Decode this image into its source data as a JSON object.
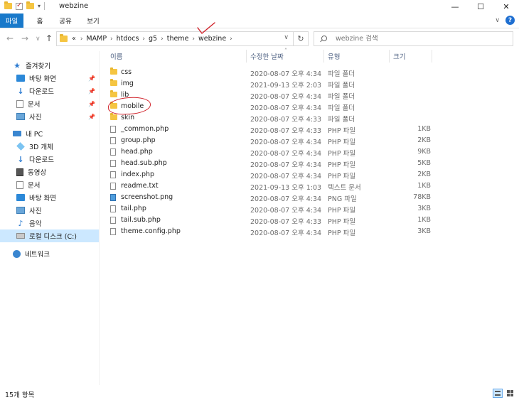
{
  "window": {
    "title": "webzine",
    "minimize": "—",
    "maximize": "☐",
    "close": "✕"
  },
  "ribbon": {
    "tabs": [
      "파일",
      "홈",
      "공유",
      "보기"
    ]
  },
  "address": {
    "prefix": "«",
    "crumbs": [
      "MAMP",
      "htdocs",
      "g5",
      "theme",
      "webzine"
    ],
    "search_placeholder": "webzine 검색"
  },
  "sidebar": {
    "quick_access": "즐겨찾기",
    "quick_items": [
      "바탕 화면",
      "다운로드",
      "문서",
      "사진"
    ],
    "this_pc": "내 PC",
    "pc_items": [
      "3D 개체",
      "다운로드",
      "동영상",
      "문서",
      "바탕 화면",
      "사진",
      "음악",
      "로컬 디스크 (C:)"
    ],
    "network": "네트워크",
    "selected": "로컬 디스크 (C:)"
  },
  "columns": {
    "name": "이름",
    "date": "수정한 날짜",
    "type": "유형",
    "size": "크기"
  },
  "files": [
    {
      "name": "css",
      "date": "2020-08-07 오후 4:34",
      "type": "파일 폴더",
      "size": "",
      "kind": "folder"
    },
    {
      "name": "img",
      "date": "2021-09-13 오후 2:03",
      "type": "파일 폴더",
      "size": "",
      "kind": "folder"
    },
    {
      "name": "lib",
      "date": "2020-08-07 오후 4:34",
      "type": "파일 폴더",
      "size": "",
      "kind": "folder"
    },
    {
      "name": "mobile",
      "date": "2020-08-07 오후 4:34",
      "type": "파일 폴더",
      "size": "",
      "kind": "folder"
    },
    {
      "name": "skin",
      "date": "2020-08-07 오후 4:33",
      "type": "파일 폴더",
      "size": "",
      "kind": "folder"
    },
    {
      "name": "_common.php",
      "date": "2020-08-07 오후 4:33",
      "type": "PHP 파일",
      "size": "1KB",
      "kind": "file"
    },
    {
      "name": "group.php",
      "date": "2020-08-07 오후 4:34",
      "type": "PHP 파일",
      "size": "2KB",
      "kind": "file"
    },
    {
      "name": "head.php",
      "date": "2020-08-07 오후 4:34",
      "type": "PHP 파일",
      "size": "9KB",
      "kind": "file"
    },
    {
      "name": "head.sub.php",
      "date": "2020-08-07 오후 4:34",
      "type": "PHP 파일",
      "size": "5KB",
      "kind": "file"
    },
    {
      "name": "index.php",
      "date": "2020-08-07 오후 4:34",
      "type": "PHP 파일",
      "size": "2KB",
      "kind": "file"
    },
    {
      "name": "readme.txt",
      "date": "2021-09-13 오후 1:03",
      "type": "텍스트 문서",
      "size": "1KB",
      "kind": "file"
    },
    {
      "name": "screenshot.png",
      "date": "2020-08-07 오후 4:34",
      "type": "PNG 파일",
      "size": "78KB",
      "kind": "png"
    },
    {
      "name": "tail.php",
      "date": "2020-08-07 오후 4:34",
      "type": "PHP 파일",
      "size": "3KB",
      "kind": "file"
    },
    {
      "name": "tail.sub.php",
      "date": "2020-08-07 오후 4:33",
      "type": "PHP 파일",
      "size": "1KB",
      "kind": "file"
    },
    {
      "name": "theme.config.php",
      "date": "2020-08-07 오후 4:34",
      "type": "PHP 파일",
      "size": "3KB",
      "kind": "file"
    }
  ],
  "status": {
    "item_count": "15개 항목"
  },
  "colors": {
    "accent": "#1979ca",
    "selected_bg": "#cce8ff",
    "annotation": "#d0222a"
  }
}
